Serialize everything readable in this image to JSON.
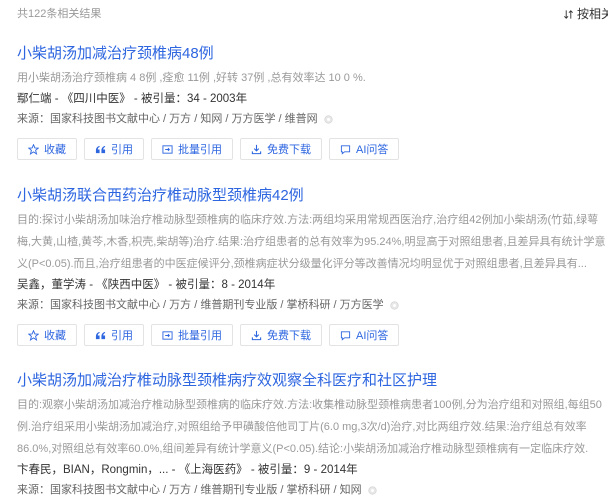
{
  "header": {
    "result_count": "共122条相关结果",
    "sort_label": "按相关"
  },
  "actions": [
    {
      "label": "收藏",
      "icon": "star-icon"
    },
    {
      "label": "引用",
      "icon": "quote-icon"
    },
    {
      "label": "批量引用",
      "icon": "batch-cite-icon"
    },
    {
      "label": "免费下载",
      "icon": "download-icon"
    },
    {
      "label": "AI问答",
      "icon": "chat-icon"
    }
  ],
  "meta_separator": " - ",
  "source_label": "来源：",
  "results": [
    {
      "title": "小柴胡汤加减治疗颈椎病48例",
      "abstract_lines": [
        "用小柴胡汤治疗颈椎病 4 8例 ,痊愈 11例 ,好转 37例 ,总有效率达 10 0 %."
      ],
      "authors": "鄢仁端",
      "journal": "《四川中医》",
      "citations": "被引量：34",
      "year": "2003年",
      "sources": "国家科技图书文献中心 / 万方 / 知网 / 万方医学 / 维普网"
    },
    {
      "title": "小柴胡汤联合西药治疗椎动脉型颈椎病42例",
      "abstract_lines": [
        "目的:探讨小柴胡汤加味治疗椎动脉型颈椎病的临床疗效.方法:两组均采用常规西医治疗,治疗组42例加小柴胡汤(竹茹,绿萼",
        "梅,大黄,山楂,黄芩,木香,枳壳,柴胡等)治疗.结果:治疗组患者的总有效率为95.24%,明显高于对照组患者,且差异具有统计学意",
        "义(P<0.05).而且,治疗组患者的中医症候评分,颈椎病症状分级量化评分等改善情况均明显优于对照组患者,且差异具有..."
      ],
      "authors": "吴鑫，董学涛",
      "journal": "《陕西中医》",
      "citations": "被引量：8",
      "year": "2014年",
      "sources": "国家科技图书文献中心 / 万方 / 维普期刊专业版 / 掌桥科研 / 万方医学"
    },
    {
      "title": "小柴胡汤加减治疗椎动脉型颈椎病疗效观察全科医疗和社区护理",
      "abstract_lines": [
        "目的:观察小柴胡汤加减治疗椎动脉型颈椎病的临床疗效.方法:收集椎动脉型颈椎病患者100例,分为治疗组和对照组,每组50",
        "例.治疗组采用小柴胡汤加减治疗,对照组给予甲磺酸倍他司丁片(6.0 mg,3次/d)治疗,对比两组疗效.结果:治疗组总有效率",
        "86.0%,对照组总有效率60.0%,组间差异有统计学意义(P<0.05).结论:小柴胡汤加减治疗椎动脉型颈椎病有一定临床疗效."
      ],
      "authors": "卞春民，BIAN，Rongmin，...",
      "journal": "《上海医药》",
      "citations": "被引量：9",
      "year": "2014年",
      "sources": "国家科技图书文献中心 / 万方 / 维普期刊专业版 / 掌桥科研 / 知网"
    }
  ],
  "colors": {
    "link": "#2e66e0",
    "abstract": "#999999",
    "meta": "#333333",
    "source": "#666666",
    "border": "#e3e3e3"
  }
}
